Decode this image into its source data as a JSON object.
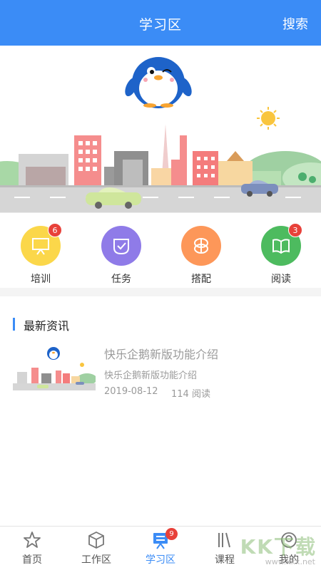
{
  "header": {
    "title": "学习区",
    "search_label": "搜索"
  },
  "quick_entries": [
    {
      "label": "培训",
      "icon": "presentation-board-icon",
      "color": "#fbd74a",
      "badge": "6"
    },
    {
      "label": "任务",
      "icon": "task-check-icon",
      "color": "#8f7be8",
      "badge": ""
    },
    {
      "label": "搭配",
      "icon": "match-icon",
      "color": "#fd9759",
      "badge": ""
    },
    {
      "label": "阅读",
      "icon": "open-book-icon",
      "color": "#4dbb5f",
      "badge": "3"
    }
  ],
  "news": {
    "section_title": "最新资讯",
    "articles": [
      {
        "title": "快乐企鹅新版功能介绍",
        "summary": "快乐企鹅新版功能介绍",
        "date": "2019-08-12",
        "views": "114 阅读"
      }
    ]
  },
  "tabbar": {
    "tabs": [
      {
        "label": "首页",
        "icon": "home-star-icon"
      },
      {
        "label": "工作区",
        "icon": "cube-icon"
      },
      {
        "label": "学习区",
        "icon": "study-board-icon",
        "badge": "9",
        "active": true
      },
      {
        "label": "课程",
        "icon": "books-icon"
      },
      {
        "label": "我的",
        "icon": "user-icon"
      }
    ]
  },
  "watermark": {
    "text": "KK下载",
    "url": "www.kkx.net"
  },
  "colors": {
    "primary": "#3b8cf6",
    "badge": "#e8413a"
  }
}
